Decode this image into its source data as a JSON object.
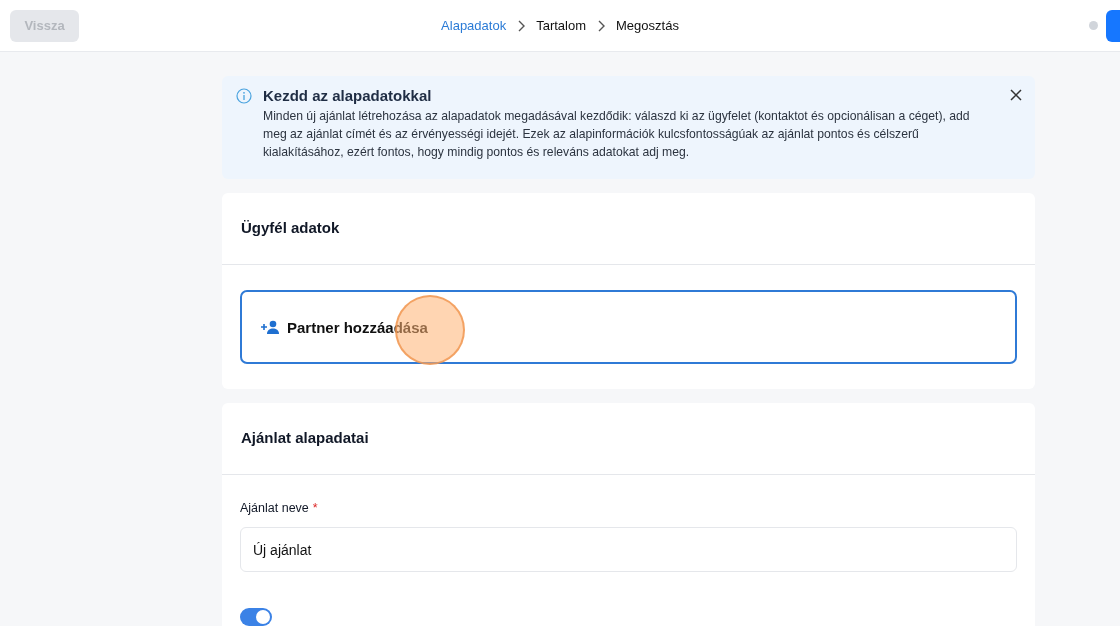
{
  "header": {
    "back_button": {
      "label": "Vissza",
      "disabled": true
    },
    "breadcrumbs": [
      {
        "label": "Alapadatok",
        "selected": true
      },
      {
        "label": "Tartalom",
        "selected": false
      },
      {
        "label": "Megosztás",
        "selected": false
      }
    ]
  },
  "alert": {
    "title": "Kezdd az alapadatokkal",
    "text": "Minden új ajánlat létrehozása az alapadatok megadásával kezdődik: válaszd ki az ügyfelet (kontaktot és opcionálisan a céget), add meg az ajánlat címét és az érvényességi idejét. Ezek az alapinformációk kulcsfontosságúak az ajánlat pontos és célszerű kialakításához, ezért fontos, hogy mindig pontos és releváns adatokat adj meg."
  },
  "client_card": {
    "title": "Ügyfél adatok",
    "add_partner_button": "Partner hozzáadása"
  },
  "offer_card": {
    "title": "Ajánlat alapadatai",
    "name_field": {
      "label": "Ajánlat neve",
      "required_mark": "*",
      "value": "Új ajánlat"
    },
    "toggle": {
      "on": true
    }
  }
}
